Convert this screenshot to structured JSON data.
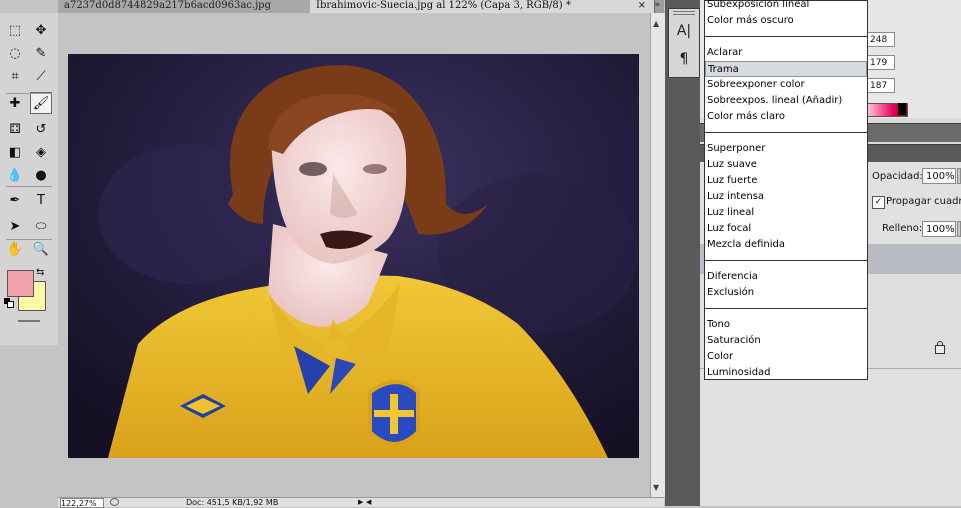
{
  "tabs": [
    {
      "label": "a7237d0d8744829a217b6acd0963ac.jpg"
    },
    {
      "label": "Ibrahimovic-Suecia.jpg al 122% (Capa 3, RGB/8) *",
      "close": "×"
    }
  ],
  "tab_scroll": "»",
  "colors": {
    "foreground": "#f4a3ad",
    "background": "#fdf7a7"
  },
  "tools": [
    {
      "name": "marquee-tool-icon",
      "glyph": "⬚"
    },
    {
      "name": "move-tool-icon",
      "glyph": "✥"
    },
    {
      "name": "lasso-tool-icon",
      "glyph": "◌"
    },
    {
      "name": "quick-select-tool-icon",
      "glyph": "✎"
    },
    {
      "name": "crop-tool-icon",
      "glyph": "⌗"
    },
    {
      "name": "eyedropper-tool-icon",
      "glyph": "⟋"
    },
    {
      "name": "healing-brush-tool-icon",
      "glyph": "✚"
    },
    {
      "name": "brush-tool-icon",
      "glyph": "🖌"
    },
    {
      "name": "clone-stamp-tool-icon",
      "glyph": "⚃"
    },
    {
      "name": "history-brush-tool-icon",
      "glyph": "↺"
    },
    {
      "name": "eraser-tool-icon",
      "glyph": "◧"
    },
    {
      "name": "paint-bucket-tool-icon",
      "glyph": "◈"
    },
    {
      "name": "blur-tool-icon",
      "glyph": "💧"
    },
    {
      "name": "dodge-tool-icon",
      "glyph": "●"
    },
    {
      "name": "pen-tool-icon",
      "glyph": "✒"
    },
    {
      "name": "type-tool-icon",
      "glyph": "T"
    },
    {
      "name": "path-select-tool-icon",
      "glyph": "➤"
    },
    {
      "name": "shape-tool-icon",
      "glyph": "⬭"
    },
    {
      "name": "hand-tool-icon",
      "glyph": "✋"
    },
    {
      "name": "zoom-tool-icon",
      "glyph": "🔍"
    }
  ],
  "status": {
    "zoom": "122,27%",
    "doc": "Doc: 451,5 KB/1,92 MB",
    "arrow": "▶",
    "scroll_left": "◀"
  },
  "scroll": {
    "up": "▲",
    "down": "▼"
  },
  "dock": {
    "char_icon": "A|",
    "para_icon": "¶"
  },
  "color_panel": {
    "r": "248",
    "g": "179",
    "b": "187"
  },
  "layers": {
    "opacity_label": "Opacidad:",
    "opacity_value": "100%",
    "propagar_label": "Propagar cuadro",
    "check_mark": "✓",
    "fill_label": "Relleno:",
    "fill_value": "100%"
  },
  "blend_modes": {
    "groups": [
      [
        "Subexposición lineal",
        "Color más oscuro"
      ],
      [
        "Aclarar",
        "Trama",
        "Sobreexponer color",
        "Sobreexpos. lineal (Añadir)",
        "Color más claro"
      ],
      [
        "Superponer",
        "Luz suave",
        "Luz fuerte",
        "Luz intensa",
        "Luz lineal",
        "Luz focal",
        "Mezcla definida"
      ],
      [
        "Diferencia",
        "Exclusión"
      ],
      [
        "Tono",
        "Saturación",
        "Color",
        "Luminosidad"
      ]
    ],
    "selected": "Trama"
  }
}
